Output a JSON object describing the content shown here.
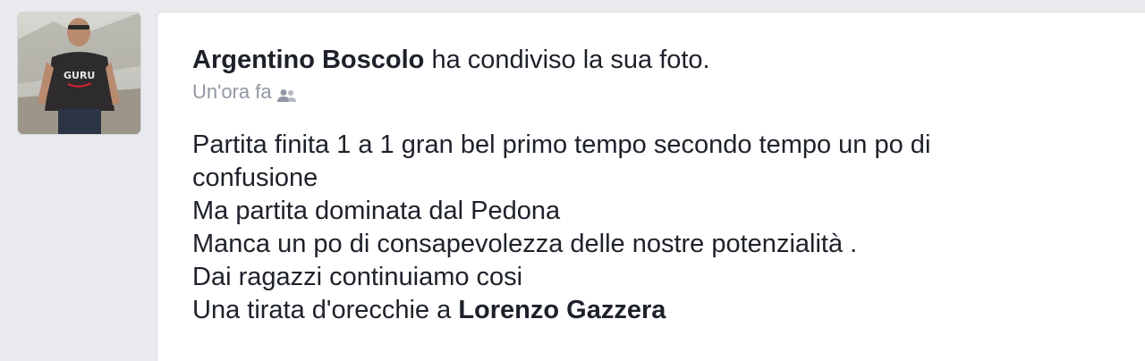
{
  "post": {
    "author": "Argentino Boscolo",
    "action": " ha condiviso la sua foto.",
    "time": "Un'ora fa",
    "privacy_icon": "friends-icon",
    "lines": [
      "Partita finita 1 a 1 gran bel primo tempo secondo tempo un po di",
      "confusione",
      "Ma partita dominata dal Pedona",
      "Manca un po di consapevolezza delle nostre potenzialità .",
      "Dai ragazzi continuiamo cosi"
    ],
    "last_line_prefix": "Una tirata d'orecchie a ",
    "mention": "Lorenzo Gazzera"
  },
  "colors": {
    "background": "#e9eaed",
    "card": "#ffffff",
    "text": "#1d2129",
    "meta": "#9197a3"
  }
}
